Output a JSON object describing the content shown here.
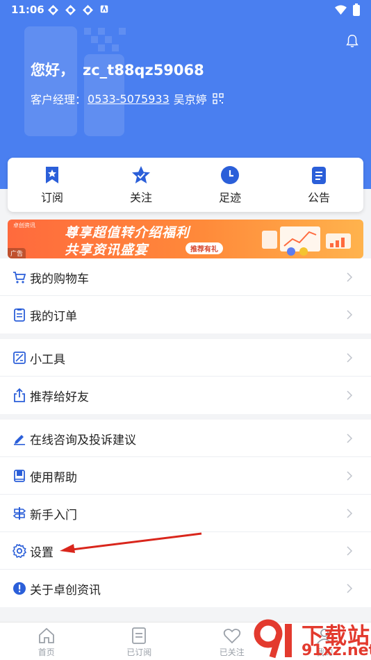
{
  "status_bar": {
    "time": "11:06"
  },
  "header": {
    "greeting": "您好，",
    "username": "zc_t88qz59068",
    "manager_label": "客户经理：",
    "manager_phone": "0533-5075933",
    "manager_name": "吴京婷"
  },
  "quick_tabs": [
    {
      "label": "订阅",
      "icon": "bookmark-star-icon"
    },
    {
      "label": "关注",
      "icon": "star-check-icon"
    },
    {
      "label": "足迹",
      "icon": "clock-icon"
    },
    {
      "label": "公告",
      "icon": "notice-icon"
    }
  ],
  "ad": {
    "brand": "卓创资讯",
    "line1": "尊享超值转介绍福利",
    "line2": "共享资讯盛宴",
    "tag": "推荐有礼",
    "ad_label": "广告"
  },
  "menu_groups": [
    [
      {
        "label": "我的购物车",
        "icon": "cart-icon"
      },
      {
        "label": "我的订单",
        "icon": "order-icon"
      }
    ],
    [
      {
        "label": "小工具",
        "icon": "tool-icon"
      },
      {
        "label": "推荐给好友",
        "icon": "share-icon"
      }
    ],
    [
      {
        "label": "在线咨询及投诉建议",
        "icon": "pen-icon"
      },
      {
        "label": "使用帮助",
        "icon": "book-icon"
      },
      {
        "label": "新手入门",
        "icon": "signpost-icon"
      },
      {
        "label": "设置",
        "icon": "gear-icon"
      },
      {
        "label": "关于卓创资讯",
        "icon": "info-icon"
      }
    ]
  ],
  "bottom_nav": [
    {
      "label": "首页",
      "icon": "home-icon"
    },
    {
      "label": "已订阅",
      "icon": "subscribed-icon"
    },
    {
      "label": "已关注",
      "icon": "heart-icon"
    },
    {
      "label": "我的",
      "icon": "user-icon"
    }
  ],
  "watermark": {
    "big": "下载站",
    "small": "91xz.net"
  },
  "colors": {
    "header_blue": "#4a7ff0",
    "icon_blue": "#2b5fd9",
    "arrow_red": "#d9261c"
  }
}
